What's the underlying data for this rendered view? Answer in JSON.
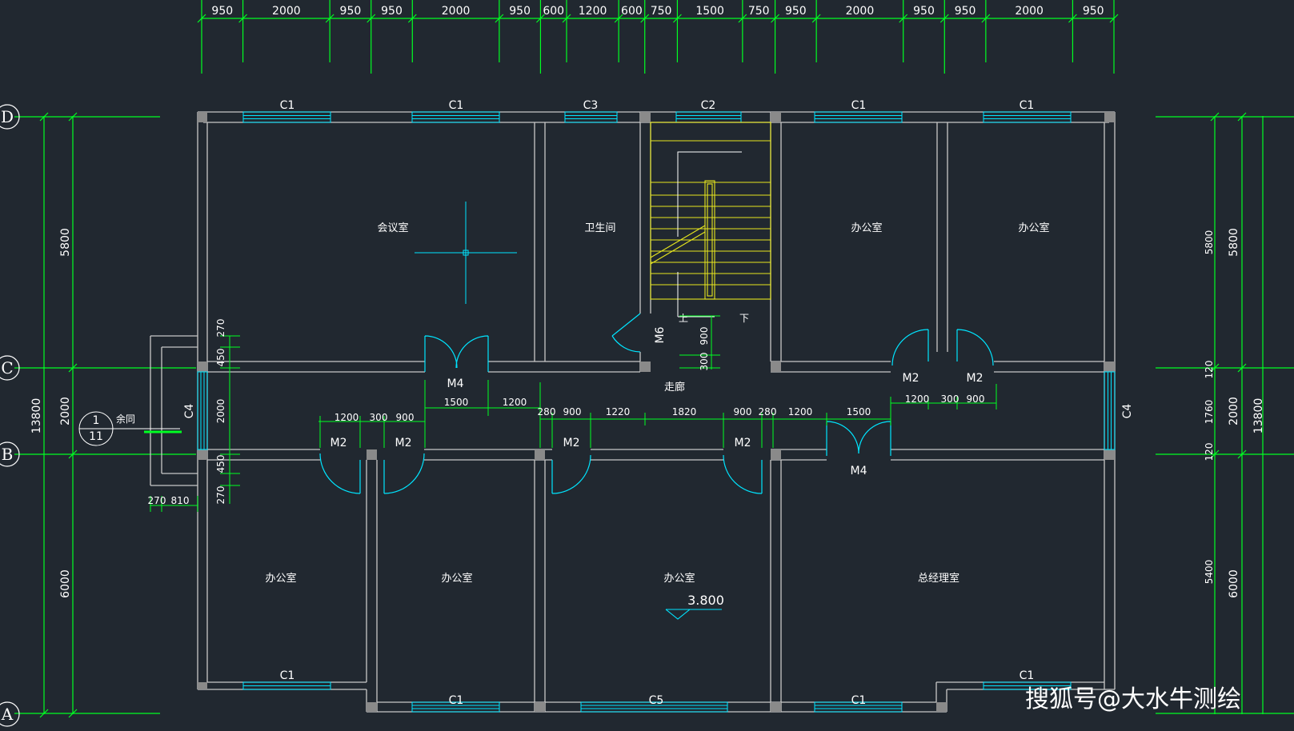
{
  "colors": {
    "background": "#212830",
    "wall": "#c8c8c8",
    "dimension": "#00ff22",
    "window": "#00e5ff",
    "stair": "#e6e61e"
  },
  "dimensions_top": [
    "950",
    "2000",
    "950",
    "950",
    "2000",
    "950",
    "600",
    "1200",
    "600",
    "750",
    "1500",
    "750",
    "950",
    "2000",
    "950",
    "950",
    "2000",
    "950"
  ],
  "grid_labels": {
    "d": "D",
    "c": "C",
    "b": "B",
    "a": "A"
  },
  "dimensions_left": {
    "d_c": "5800",
    "c_b": "2000",
    "b_a": "6000",
    "total": "13800"
  },
  "dimensions_right": {
    "d_c": "5800",
    "c_b": "2000",
    "b_a": "6000",
    "total": "13800",
    "inner_d_c": "5800",
    "inner_c1": "120",
    "inner_c_b": "1760",
    "inner_b1": "120",
    "inner_b_a": "5400"
  },
  "rooms": {
    "meeting": "会议室",
    "toilet": "卫生间",
    "office_tl": "办公室",
    "office_tr": "办公室",
    "office_bl": "办公室",
    "office_bm": "办公室",
    "office_bc": "办公室",
    "manager": "总经理室",
    "corridor": "走廊"
  },
  "windows": {
    "c1": "C1",
    "c2": "C2",
    "c3": "C3",
    "c4": "C4",
    "c5": "C5"
  },
  "doors": {
    "m2": "M2",
    "m4": "M4",
    "m6": "M6"
  },
  "stair": {
    "up": "上",
    "down": "下",
    "d1": "900",
    "d2": "300"
  },
  "section": {
    "num": "1",
    "sheet": "11",
    "label": "余同"
  },
  "corridor_dims": {
    "a1": "1200",
    "a2": "300",
    "a3": "900",
    "b1": "1500",
    "b2": "1200",
    "c1": "280",
    "c2": "900",
    "c3": "1220",
    "c4": "1820",
    "c5": "900",
    "c6": "280",
    "d1": "1200",
    "d2": "1500",
    "e1": "1200",
    "e2": "300",
    "e3": "900"
  },
  "wall_dims": {
    "w270a": "270",
    "w450a": "450",
    "w2000": "2000",
    "w450b": "450",
    "w270b": "270",
    "p270": "270",
    "p810": "810"
  },
  "elevation": "3.800",
  "watermark": "搜狐号@大水牛测绘"
}
